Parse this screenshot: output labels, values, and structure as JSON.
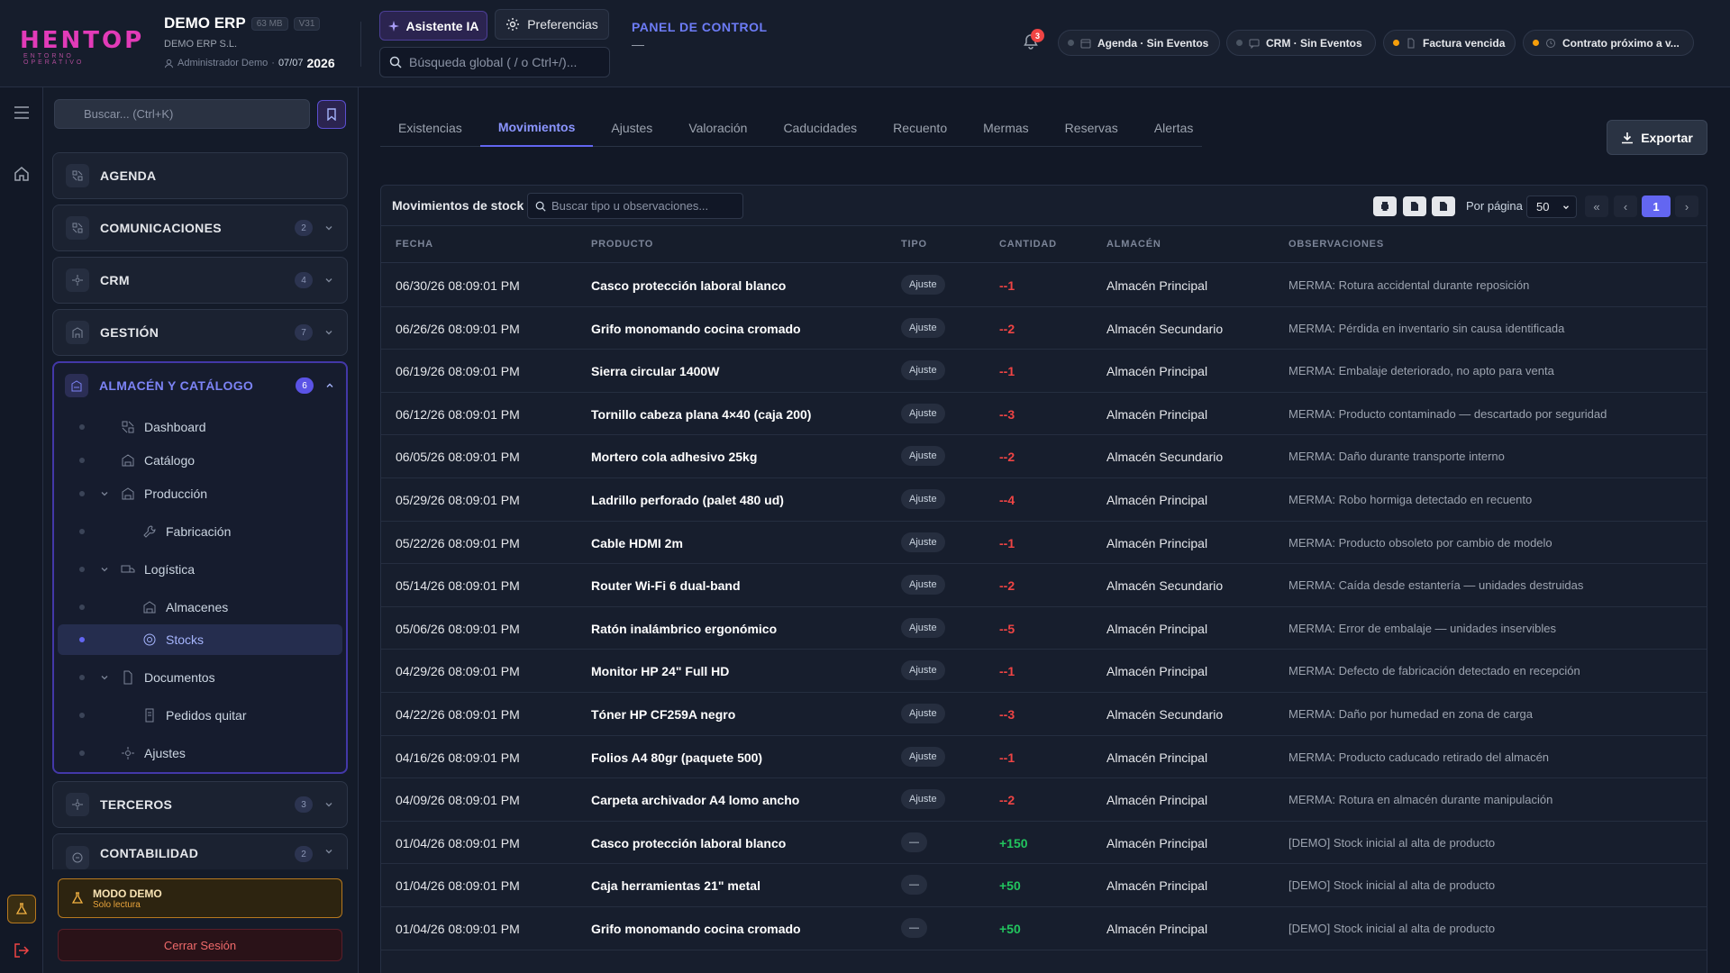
{
  "header": {
    "logo": "HENTOP",
    "logo_sub": "ENTORNO OPERATIVO",
    "company_name": "DEMO ERP",
    "size_badge": "63 MB",
    "version_badge": "V31",
    "company_legal": "DEMO ERP S.L.",
    "user": "Administrador Demo",
    "date_short": "07/07",
    "year": "2026",
    "ai_button": "Asistente IA",
    "prefs_button": "Preferencias",
    "search_placeholder": "Búsqueda global ( / o Ctrl+/)...",
    "panel_title": "PANEL DE CONTROL",
    "panel_sub": "—",
    "notif_count": "3",
    "chips": [
      {
        "label": "Agenda · Sin Eventos",
        "dot": "#4b5563"
      },
      {
        "label": "CRM · Sin Eventos",
        "dot": "#4b5563"
      },
      {
        "label": "Factura vencida",
        "dot": "#f59e0b"
      },
      {
        "label": "Contrato próximo a v...",
        "dot": "#f59e0b"
      }
    ]
  },
  "sidebar": {
    "search_placeholder": "Buscar... (Ctrl+K)",
    "sections": [
      {
        "label": "AGENDA",
        "badge": ""
      },
      {
        "label": "COMUNICACIONES",
        "badge": "2"
      },
      {
        "label": "CRM",
        "badge": "4"
      },
      {
        "label": "GESTIÓN",
        "badge": "7"
      }
    ],
    "open_section": {
      "label": "ALMACÉN Y CATÁLOGO",
      "badge": "6",
      "items": [
        {
          "label": "Dashboard"
        },
        {
          "label": "Catálogo"
        },
        {
          "label": "Producción"
        },
        {
          "label": "Fabricación"
        },
        {
          "label": "Logística"
        },
        {
          "label": "Almacenes"
        },
        {
          "label": "Stocks"
        },
        {
          "label": "Documentos"
        },
        {
          "label": "Pedidos quitar"
        },
        {
          "label": "Ajustes"
        }
      ]
    },
    "bottom_sections": [
      {
        "label": "TERCEROS",
        "badge": "3"
      },
      {
        "label": "CONTABILIDAD",
        "badge": "2"
      }
    ],
    "demo_title": "MODO DEMO",
    "demo_sub": "Solo lectura",
    "logout": "Cerrar Sesión"
  },
  "tabs": [
    "Existencias",
    "Movimientos",
    "Ajustes",
    "Valoración",
    "Caducidades",
    "Recuento",
    "Mermas",
    "Reservas",
    "Alertas"
  ],
  "active_tab": "Movimientos",
  "export_button": "Exportar",
  "table": {
    "title": "Movimientos de stock",
    "search_placeholder": "Buscar tipo u observaciones...",
    "per_page_label": "Por página",
    "per_page": "50",
    "page": "1",
    "pager": {
      "first": "«",
      "prev": "‹",
      "next": "›"
    },
    "columns": [
      "FECHA",
      "PRODUCTO",
      "TIPO",
      "CANTIDAD",
      "ALMACÉN",
      "OBSERVACIONES"
    ],
    "rows": [
      {
        "fecha": "06/30/26 08:09:01 PM",
        "producto": "Casco protección laboral blanco",
        "tipo": "Ajuste",
        "cantidad": "--1",
        "almacen": "Almacén Principal",
        "obs": "MERMA: Rotura accidental durante reposición"
      },
      {
        "fecha": "06/26/26 08:09:01 PM",
        "producto": "Grifo monomando cocina cromado",
        "tipo": "Ajuste",
        "cantidad": "--2",
        "almacen": "Almacén Secundario",
        "obs": "MERMA: Pérdida en inventario sin causa identificada"
      },
      {
        "fecha": "06/19/26 08:09:01 PM",
        "producto": "Sierra circular 1400W",
        "tipo": "Ajuste",
        "cantidad": "--1",
        "almacen": "Almacén Principal",
        "obs": "MERMA: Embalaje deteriorado, no apto para venta"
      },
      {
        "fecha": "06/12/26 08:09:01 PM",
        "producto": "Tornillo cabeza plana 4×40 (caja 200)",
        "tipo": "Ajuste",
        "cantidad": "--3",
        "almacen": "Almacén Principal",
        "obs": "MERMA: Producto contaminado — descartado por seguridad"
      },
      {
        "fecha": "06/05/26 08:09:01 PM",
        "producto": "Mortero cola adhesivo 25kg",
        "tipo": "Ajuste",
        "cantidad": "--2",
        "almacen": "Almacén Secundario",
        "obs": "MERMA: Daño durante transporte interno"
      },
      {
        "fecha": "05/29/26 08:09:01 PM",
        "producto": "Ladrillo perforado (palet 480 ud)",
        "tipo": "Ajuste",
        "cantidad": "--4",
        "almacen": "Almacén Principal",
        "obs": "MERMA: Robo hormiga detectado en recuento"
      },
      {
        "fecha": "05/22/26 08:09:01 PM",
        "producto": "Cable HDMI 2m",
        "tipo": "Ajuste",
        "cantidad": "--1",
        "almacen": "Almacén Principal",
        "obs": "MERMA: Producto obsoleto por cambio de modelo"
      },
      {
        "fecha": "05/14/26 08:09:01 PM",
        "producto": "Router Wi-Fi 6 dual-band",
        "tipo": "Ajuste",
        "cantidad": "--2",
        "almacen": "Almacén Secundario",
        "obs": "MERMA: Caída desde estantería — unidades destruidas"
      },
      {
        "fecha": "05/06/26 08:09:01 PM",
        "producto": "Ratón inalámbrico ergonómico",
        "tipo": "Ajuste",
        "cantidad": "--5",
        "almacen": "Almacén Principal",
        "obs": "MERMA: Error de embalaje — unidades inservibles"
      },
      {
        "fecha": "04/29/26 08:09:01 PM",
        "producto": "Monitor HP 24\" Full HD",
        "tipo": "Ajuste",
        "cantidad": "--1",
        "almacen": "Almacén Principal",
        "obs": "MERMA: Defecto de fabricación detectado en recepción"
      },
      {
        "fecha": "04/22/26 08:09:01 PM",
        "producto": "Tóner HP CF259A negro",
        "tipo": "Ajuste",
        "cantidad": "--3",
        "almacen": "Almacén Secundario",
        "obs": "MERMA: Daño por humedad en zona de carga"
      },
      {
        "fecha": "04/16/26 08:09:01 PM",
        "producto": "Folios A4 80gr (paquete 500)",
        "tipo": "Ajuste",
        "cantidad": "--1",
        "almacen": "Almacén Principal",
        "obs": "MERMA: Producto caducado retirado del almacén"
      },
      {
        "fecha": "04/09/26 08:09:01 PM",
        "producto": "Carpeta archivador A4 lomo ancho",
        "tipo": "Ajuste",
        "cantidad": "--2",
        "almacen": "Almacén Principal",
        "obs": "MERMA: Rotura en almacén durante manipulación"
      },
      {
        "fecha": "01/04/26 08:09:01 PM",
        "producto": "Casco protección laboral blanco",
        "tipo": "—",
        "cantidad": "+150",
        "almacen": "Almacén Principal",
        "obs": "[DEMO] Stock inicial al alta de producto"
      },
      {
        "fecha": "01/04/26 08:09:01 PM",
        "producto": "Caja herramientas 21\" metal",
        "tipo": "—",
        "cantidad": "+50",
        "almacen": "Almacén Principal",
        "obs": "[DEMO] Stock inicial al alta de producto"
      },
      {
        "fecha": "01/04/26 08:09:01 PM",
        "producto": "Grifo monomando cocina cromado",
        "tipo": "—",
        "cantidad": "+50",
        "almacen": "Almacén Principal",
        "obs": "[DEMO] Stock inicial al alta de producto"
      }
    ]
  },
  "colors": {
    "accent": "#6366f1",
    "negative": "#ef4444",
    "positive": "#22c55e",
    "warning": "#f59e0b"
  }
}
